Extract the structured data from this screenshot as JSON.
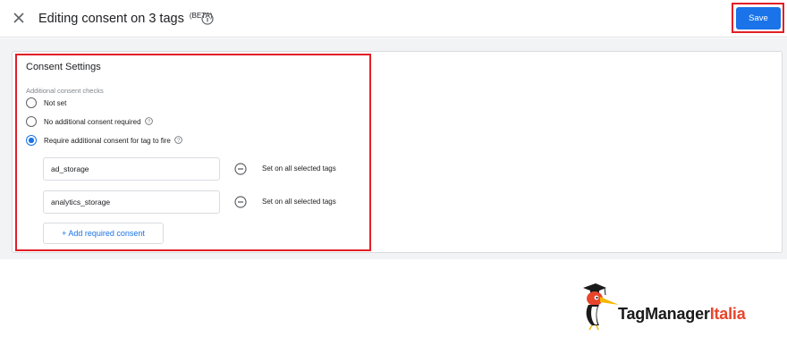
{
  "header": {
    "title": "Editing consent on 3 tags",
    "beta": "(BETA)",
    "save_label": "Save"
  },
  "card": {
    "title": "Consent Settings",
    "section_label": "Additional consent checks",
    "options": [
      {
        "label": "Not set",
        "checked": false
      },
      {
        "label": "No additional consent required",
        "checked": false
      },
      {
        "label": "Require additional consent for tag to fire",
        "checked": true
      }
    ],
    "consents": [
      {
        "value": "ad_storage",
        "note": "Set on all selected tags"
      },
      {
        "value": "analytics_storage",
        "note": "Set on all selected tags"
      }
    ],
    "add_label": "+ Add required consent"
  },
  "logo": {
    "part1": "TagManager",
    "part2": "Italia"
  },
  "colors": {
    "accent": "#1a73e8",
    "highlight": "#e21f26",
    "logo_red": "#e8452c"
  }
}
